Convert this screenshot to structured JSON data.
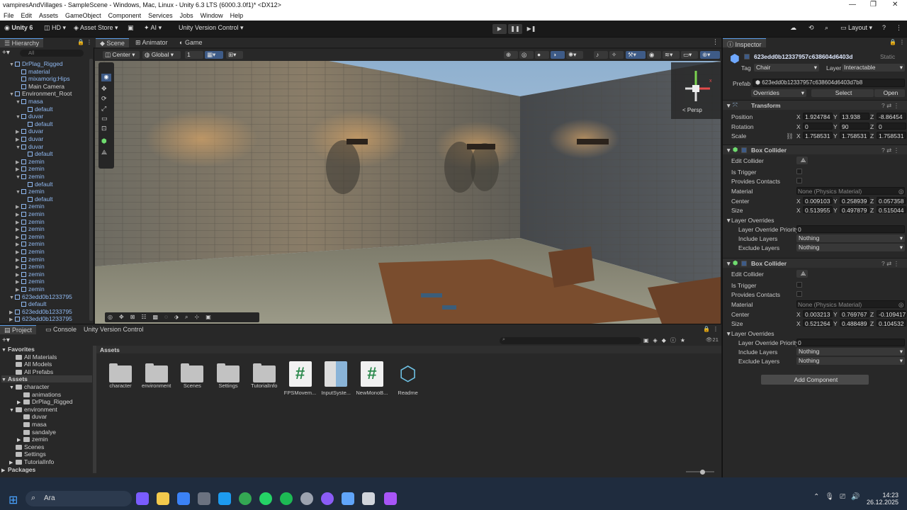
{
  "window": {
    "title": "vampiresAndVillages - SampleScene - Windows, Mac, Linux - Unity 6.3 LTS (6000.3.0f1)* <DX12>"
  },
  "menu": [
    "File",
    "Edit",
    "Assets",
    "GameObject",
    "Component",
    "Services",
    "Jobs",
    "Window",
    "Help"
  ],
  "toolbar": {
    "account": "Unity 6",
    "hd": "HD",
    "asset_store": "Asset Store",
    "ai": "AI",
    "vcs": "Unity Version Control",
    "layout": "Layout"
  },
  "hierarchy": {
    "tab": "Hierarchy",
    "search_placeholder": "All",
    "items": [
      {
        "label": "DrPlag_Rigged",
        "indent": 1,
        "arrow": "▼"
      },
      {
        "label": "material",
        "indent": 2,
        "arrow": ""
      },
      {
        "label": "mixamorig:Hips",
        "indent": 2,
        "arrow": ""
      },
      {
        "label": "Main Camera",
        "indent": 2,
        "arrow": "",
        "white": true
      },
      {
        "label": "Environment_Root",
        "indent": 1,
        "arrow": "▼",
        "white": true
      },
      {
        "label": "masa",
        "indent": 2,
        "arrow": "▼"
      },
      {
        "label": "default",
        "indent": 3,
        "arrow": ""
      },
      {
        "label": "duvar",
        "indent": 2,
        "arrow": "▼"
      },
      {
        "label": "default",
        "indent": 3,
        "arrow": ""
      },
      {
        "label": "duvar",
        "indent": 2,
        "arrow": "▶"
      },
      {
        "label": "duvar",
        "indent": 2,
        "arrow": "▶"
      },
      {
        "label": "duvar",
        "indent": 2,
        "arrow": "▼"
      },
      {
        "label": "default",
        "indent": 3,
        "arrow": ""
      },
      {
        "label": "zemin",
        "indent": 2,
        "arrow": "▶"
      },
      {
        "label": "zemin",
        "indent": 2,
        "arrow": "▶"
      },
      {
        "label": "zemin",
        "indent": 2,
        "arrow": "▼"
      },
      {
        "label": "default",
        "indent": 3,
        "arrow": ""
      },
      {
        "label": "zemin",
        "indent": 2,
        "arrow": "▼"
      },
      {
        "label": "default",
        "indent": 3,
        "arrow": ""
      },
      {
        "label": "zemin",
        "indent": 2,
        "arrow": "▶"
      },
      {
        "label": "zemin",
        "indent": 2,
        "arrow": "▶"
      },
      {
        "label": "zemin",
        "indent": 2,
        "arrow": "▶"
      },
      {
        "label": "zemin",
        "indent": 2,
        "arrow": "▶"
      },
      {
        "label": "zemin",
        "indent": 2,
        "arrow": "▶"
      },
      {
        "label": "zemin",
        "indent": 2,
        "arrow": "▶"
      },
      {
        "label": "zemin",
        "indent": 2,
        "arrow": "▶"
      },
      {
        "label": "zemin",
        "indent": 2,
        "arrow": "▶"
      },
      {
        "label": "zemin",
        "indent": 2,
        "arrow": "▶"
      },
      {
        "label": "zemin",
        "indent": 2,
        "arrow": "▶"
      },
      {
        "label": "zemin",
        "indent": 2,
        "arrow": "▶"
      },
      {
        "label": "zemin",
        "indent": 2,
        "arrow": "▶"
      },
      {
        "label": "623edd0b1233795",
        "indent": 1,
        "arrow": "▼"
      },
      {
        "label": "default",
        "indent": 2,
        "arrow": ""
      },
      {
        "label": "623edd0b1233795",
        "indent": 1,
        "arrow": "▶"
      },
      {
        "label": "623edd0b1233795",
        "indent": 1,
        "arrow": "▶"
      }
    ]
  },
  "scene": {
    "tabs": [
      "Scene",
      "Animator",
      "Game"
    ],
    "pivot": "Center",
    "space": "Global",
    "snap_value": "1",
    "gizmo_label": "< Persp"
  },
  "project": {
    "tabs": [
      "Project",
      "Console",
      "Unity Version Control"
    ],
    "breadcrumb": "Assets",
    "count": "21",
    "tree": [
      {
        "label": "Favorites",
        "indent": 0,
        "bold": true,
        "arrow": "▼"
      },
      {
        "label": "All Materials",
        "indent": 1
      },
      {
        "label": "All Models",
        "indent": 1
      },
      {
        "label": "All Prefabs",
        "indent": 1
      },
      {
        "label": "Assets",
        "indent": 0,
        "bold": true,
        "arrow": "▼"
      },
      {
        "label": "character",
        "indent": 1,
        "arrow": "▼"
      },
      {
        "label": "animations",
        "indent": 2
      },
      {
        "label": "DrPlag_Rigged",
        "indent": 2,
        "arrow": "▶"
      },
      {
        "label": "environment",
        "indent": 1,
        "arrow": "▼"
      },
      {
        "label": "duvar",
        "indent": 2
      },
      {
        "label": "masa",
        "indent": 2
      },
      {
        "label": "sandalye",
        "indent": 2
      },
      {
        "label": "zemin",
        "indent": 2,
        "arrow": "▶"
      },
      {
        "label": "Scenes",
        "indent": 1
      },
      {
        "label": "Settings",
        "indent": 1
      },
      {
        "label": "TutorialInfo",
        "indent": 1,
        "arrow": "▶"
      },
      {
        "label": "Packages",
        "indent": 0,
        "bold": true,
        "arrow": "▶"
      }
    ],
    "assets": [
      {
        "label": "character",
        "kind": "folder"
      },
      {
        "label": "environment",
        "kind": "folder"
      },
      {
        "label": "Scenes",
        "kind": "folder"
      },
      {
        "label": "Settings",
        "kind": "folder"
      },
      {
        "label": "TutorialInfo",
        "kind": "folder"
      },
      {
        "label": "FPSMovem...",
        "kind": "script"
      },
      {
        "label": "InputSyste...",
        "kind": "input"
      },
      {
        "label": "NewMonoB...",
        "kind": "script"
      },
      {
        "label": "Readme",
        "kind": "readme"
      }
    ]
  },
  "inspector": {
    "tab": "Inspector",
    "object_name": "623edd0b12337957c638604d6403d",
    "static": "Static",
    "tag_label": "Tag",
    "tag": "Chair",
    "layer_label": "Layer",
    "layer": "Interactable",
    "prefab_label": "Prefab",
    "prefab": "623edd0b12337957c638604d6403d7b8",
    "overrides": "Overrides",
    "select": "Select",
    "open": "Open",
    "transform": {
      "title": "Transform",
      "position": {
        "label": "Position",
        "x": "1.924784",
        "y": "13.938",
        "z": "-8.86454"
      },
      "rotation": {
        "label": "Rotation",
        "x": "0",
        "y": "90",
        "z": "0"
      },
      "scale": {
        "label": "Scale",
        "x": "1.758531",
        "y": "1.758531",
        "z": "1.758531"
      }
    },
    "colliders": [
      {
        "title": "Box Collider",
        "edit": "Edit Collider",
        "trigger": "Is Trigger",
        "contacts": "Provides Contacts",
        "material_label": "Material",
        "material": "None (Physics Material)",
        "center_label": "Center",
        "center": {
          "x": "0.009103",
          "y": "0.258939",
          "z": "0.057358"
        },
        "size_label": "Size",
        "size": {
          "x": "0.513955",
          "y": "0.497879",
          "z": "0.515044"
        },
        "overrides": "Layer Overrides",
        "priority_label": "Layer Override Priority",
        "priority": "0",
        "include_label": "Include Layers",
        "include": "Nothing",
        "exclude_label": "Exclude Layers",
        "exclude": "Nothing"
      },
      {
        "title": "Box Collider",
        "edit": "Edit Collider",
        "trigger": "Is Trigger",
        "contacts": "Provides Contacts",
        "material_label": "Material",
        "material": "None (Physics Material)",
        "center_label": "Center",
        "center": {
          "x": "0.003213",
          "y": "0.769767",
          "z": "-0.109417"
        },
        "size_label": "Size",
        "size": {
          "x": "0.521264",
          "y": "0.488489",
          "z": "0.104532"
        },
        "overrides": "Layer Overrides",
        "priority_label": "Layer Override Priority",
        "priority": "0",
        "include_label": "Include Layers",
        "include": "Nothing",
        "exclude_label": "Exclude Layers",
        "exclude": "Nothing"
      }
    ],
    "add_component": "Add Component"
  },
  "taskbar": {
    "search": "Ara",
    "time": "14:23",
    "date": "26.12.2025"
  },
  "colors": {
    "accent": "#5a9be6",
    "hier_blue": "#8fb8f0",
    "script_green": "#2d8a4e"
  }
}
